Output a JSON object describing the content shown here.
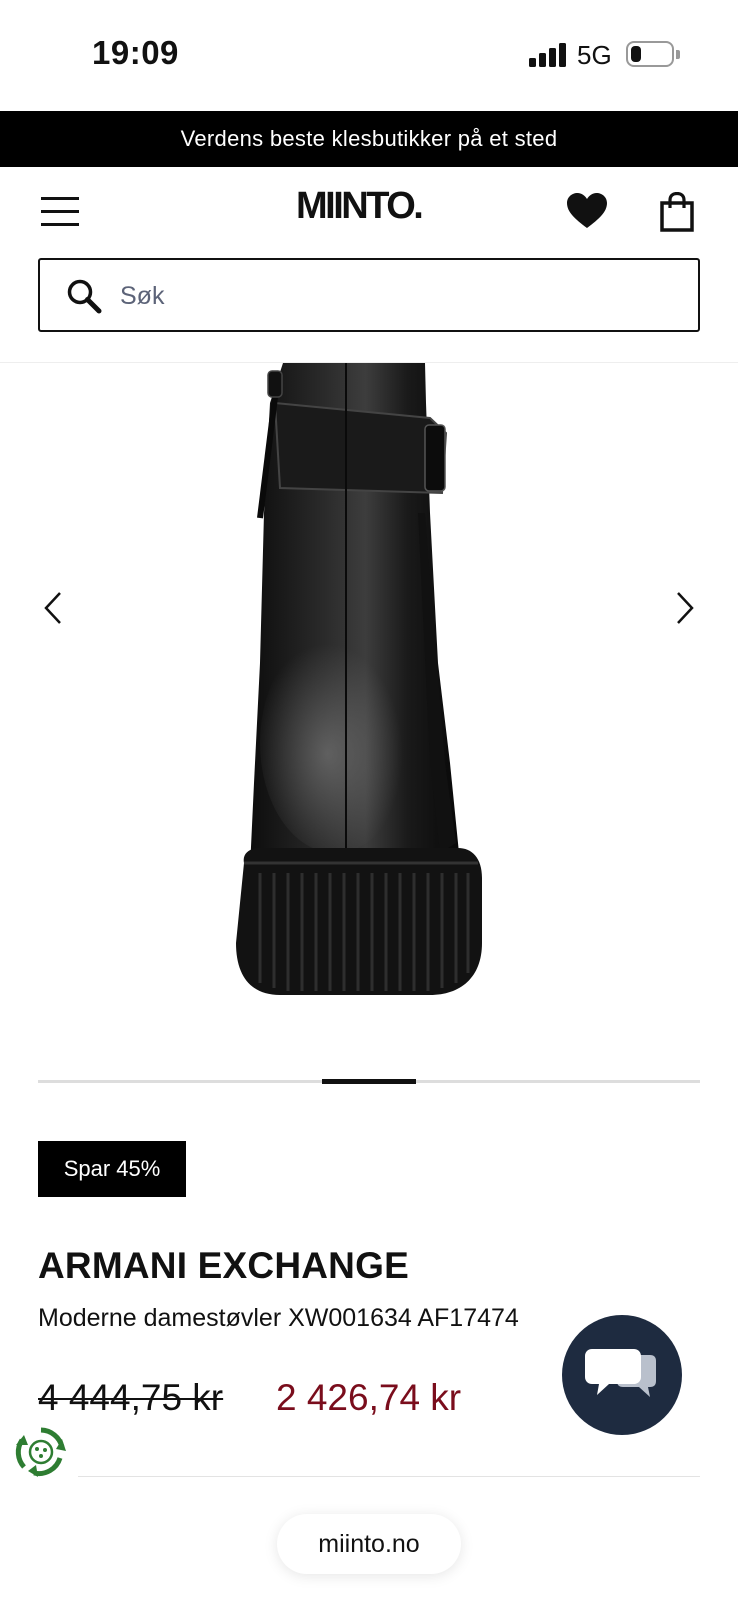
{
  "status_bar": {
    "time": "19:09",
    "network": "5G"
  },
  "promo_banner": {
    "text": "Verdens beste klesbutikker på et sted"
  },
  "header": {
    "logo": "MIINTO.",
    "menu_icon": "hamburger-menu-icon",
    "wishlist_icon": "heart-icon",
    "bag_icon": "shopping-bag-icon"
  },
  "search": {
    "placeholder": "Søk",
    "icon": "search-icon"
  },
  "gallery": {
    "image": "black-ankle-boot-rear-view",
    "prev_icon": "chevron-left-icon",
    "next_icon": "chevron-right-icon"
  },
  "product": {
    "badge": "Spar 45%",
    "brand": "ARMANI EXCHANGE",
    "name": "Moderne damestøvler XW001634 AF17474",
    "price_original": "4 444,75 kr",
    "price_sale": "2 426,74 kr"
  },
  "chat": {
    "icon": "chat-bubbles-icon"
  },
  "eco": {
    "icon": "eco-recycle-icon"
  },
  "browser": {
    "url": "miinto.no"
  },
  "colors": {
    "sale_price": "#7a0d1c",
    "chat_button": "#1e2b40",
    "banner": "#000000",
    "eco": "#2e7d32"
  }
}
